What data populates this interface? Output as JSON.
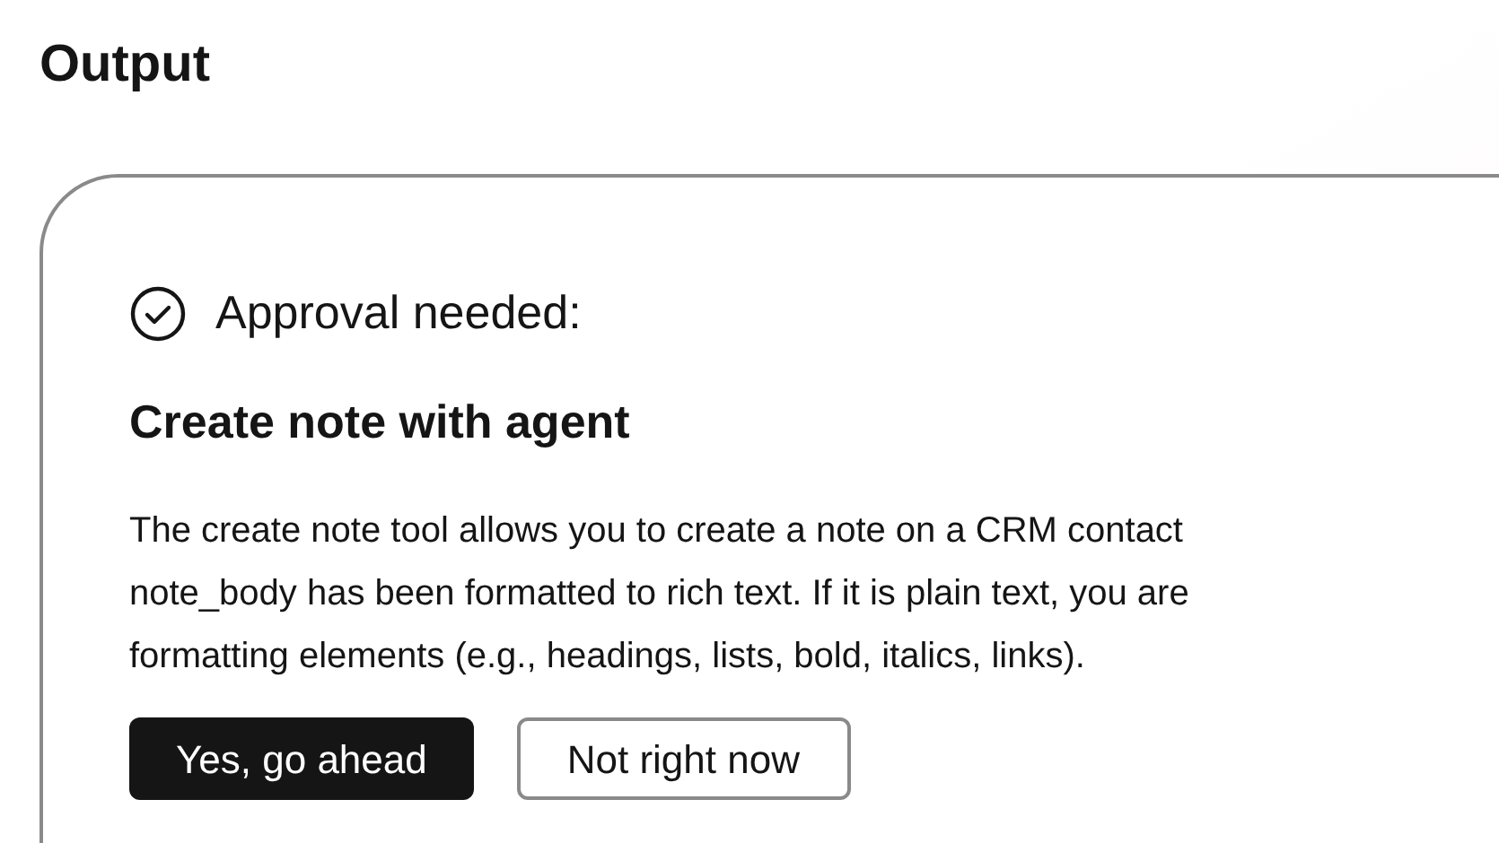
{
  "heading": "Output",
  "approval": {
    "status": "Approval needed:",
    "title": "Create note with agent",
    "description_lines": [
      "The create note tool allows you to create a note on a CRM contact",
      "note_body has been formatted to rich text. If it is plain text, you are",
      "formatting elements (e.g., headings, lists, bold, italics, links)."
    ],
    "buttons": [
      {
        "kind": "primary",
        "label": "Yes, go ahead"
      },
      {
        "kind": "secondary",
        "label": "Not right now"
      }
    ]
  }
}
